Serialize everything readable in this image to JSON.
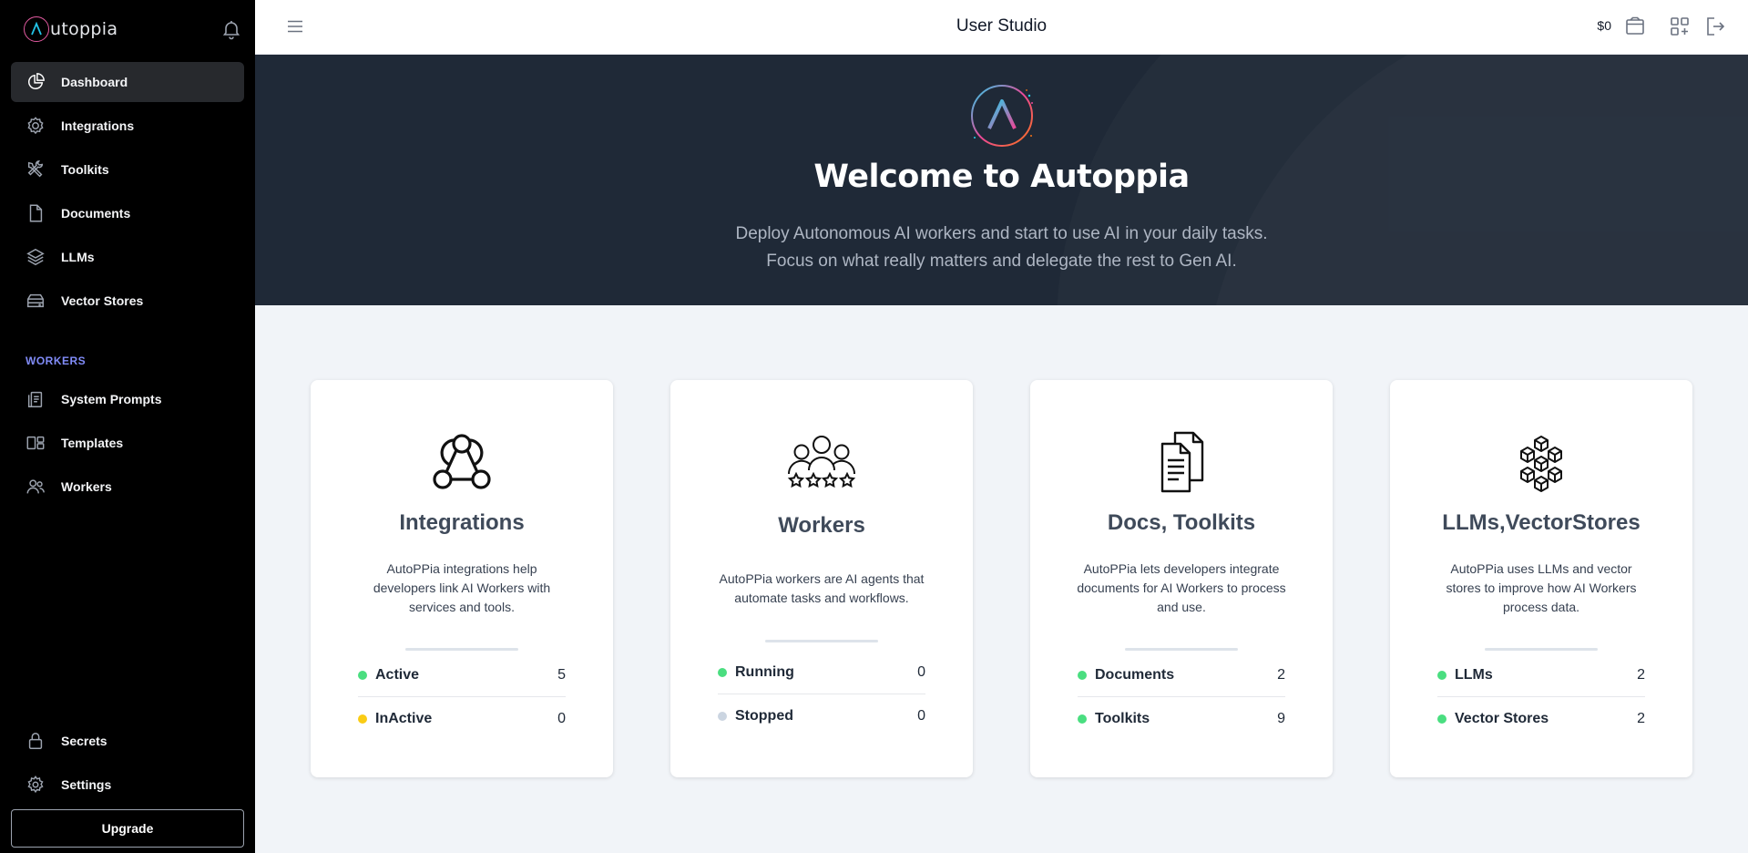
{
  "app": {
    "logo_text": "utoppia",
    "logo_letter": "A"
  },
  "sidebar": {
    "items": [
      {
        "label": "Dashboard",
        "icon": "pie-chart-icon",
        "active": true
      },
      {
        "label": "Integrations",
        "icon": "gear-badge-icon"
      },
      {
        "label": "Toolkits",
        "icon": "tools-icon"
      },
      {
        "label": "Documents",
        "icon": "file-icon"
      },
      {
        "label": "LLMs",
        "icon": "layers-icon"
      },
      {
        "label": "Vector Stores",
        "icon": "storage-icon"
      }
    ],
    "section_label": "WORKERS",
    "worker_items": [
      {
        "label": "System Prompts",
        "icon": "clipboard-icon"
      },
      {
        "label": "Templates",
        "icon": "template-icon"
      },
      {
        "label": "Workers",
        "icon": "users-icon"
      }
    ],
    "bottom_items": [
      {
        "label": "Secrets",
        "icon": "lock-icon"
      },
      {
        "label": "Settings",
        "icon": "gear-icon"
      }
    ],
    "upgrade_label": "Upgrade"
  },
  "topbar": {
    "title": "User Studio",
    "balance": "$0"
  },
  "hero": {
    "title": "Welcome to Autoppia",
    "subtitle_line1": "Deploy Autonomous AI workers and start to use AI in your daily tasks.",
    "subtitle_line2": "Focus on what really matters and delegate the rest to Gen AI."
  },
  "cards": [
    {
      "title": "Integrations",
      "icon": "webhook-icon",
      "description": "AutoPPia integrations help developers link AI Workers with services and tools.",
      "stats": [
        {
          "label": "Active",
          "value": "5",
          "color": "#4ade80"
        },
        {
          "label": "InActive",
          "value": "0",
          "color": "#facc15"
        }
      ]
    },
    {
      "title": "Workers",
      "icon": "team-rating-icon",
      "description": "AutoPPia workers are AI agents that automate tasks and workflows.",
      "stats": [
        {
          "label": "Running",
          "value": "0",
          "color": "#4ade80"
        },
        {
          "label": "Stopped",
          "value": "0",
          "color": "#cbd5e1"
        }
      ]
    },
    {
      "title": "Docs, Toolkits",
      "icon": "documents-icon",
      "description": "AutoPPia lets developers integrate documents for AI Workers to process and use.",
      "stats": [
        {
          "label": "Documents",
          "value": "2",
          "color": "#4ade80"
        },
        {
          "label": "Toolkits",
          "value": "9",
          "color": "#4ade80"
        }
      ]
    },
    {
      "title": "LLMs,VectorStores",
      "icon": "cubes-network-icon",
      "description": "AutoPPia uses LLMs and vector stores to improve how AI Workers process data.",
      "stats": [
        {
          "label": "LLMs",
          "value": "2",
          "color": "#4ade80"
        },
        {
          "label": "Vector Stores",
          "value": "2",
          "color": "#4ade80"
        }
      ]
    }
  ]
}
